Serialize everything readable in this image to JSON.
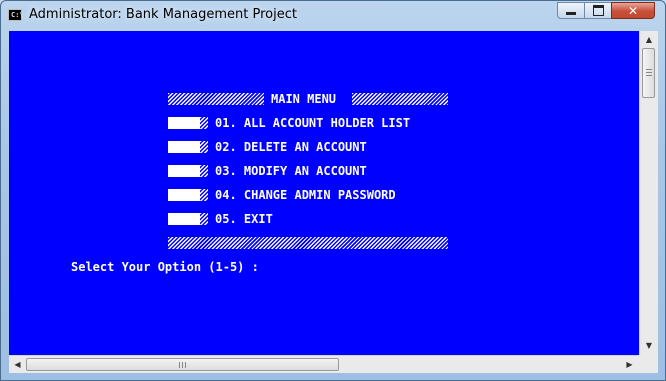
{
  "window": {
    "title": "Administrator:  Bank Management Project",
    "icon": "cmd-icon",
    "icon_text": "C:\\"
  },
  "controls": {
    "minimize_icon": "minimize-icon",
    "maximize_icon": "maximize-icon",
    "close_icon": "close-icon",
    "close_glyph": "✕"
  },
  "console": {
    "background": "#0000ff",
    "foreground": "#ffffff",
    "menu_title": "MAIN MENU",
    "items": [
      {
        "label": "01. ALL ACCOUNT HOLDER LIST"
      },
      {
        "label": "02. DELETE AN ACCOUNT"
      },
      {
        "label": "03. MODIFY AN ACCOUNT"
      },
      {
        "label": "04. CHANGE ADMIN PASSWORD"
      },
      {
        "label": "05. EXIT"
      }
    ],
    "prompt": "Select Your Option (1-5) :"
  },
  "scrollbars": {
    "up_arrow": "▲",
    "down_arrow": "▼",
    "left_arrow": "◀",
    "right_arrow": "▶"
  }
}
